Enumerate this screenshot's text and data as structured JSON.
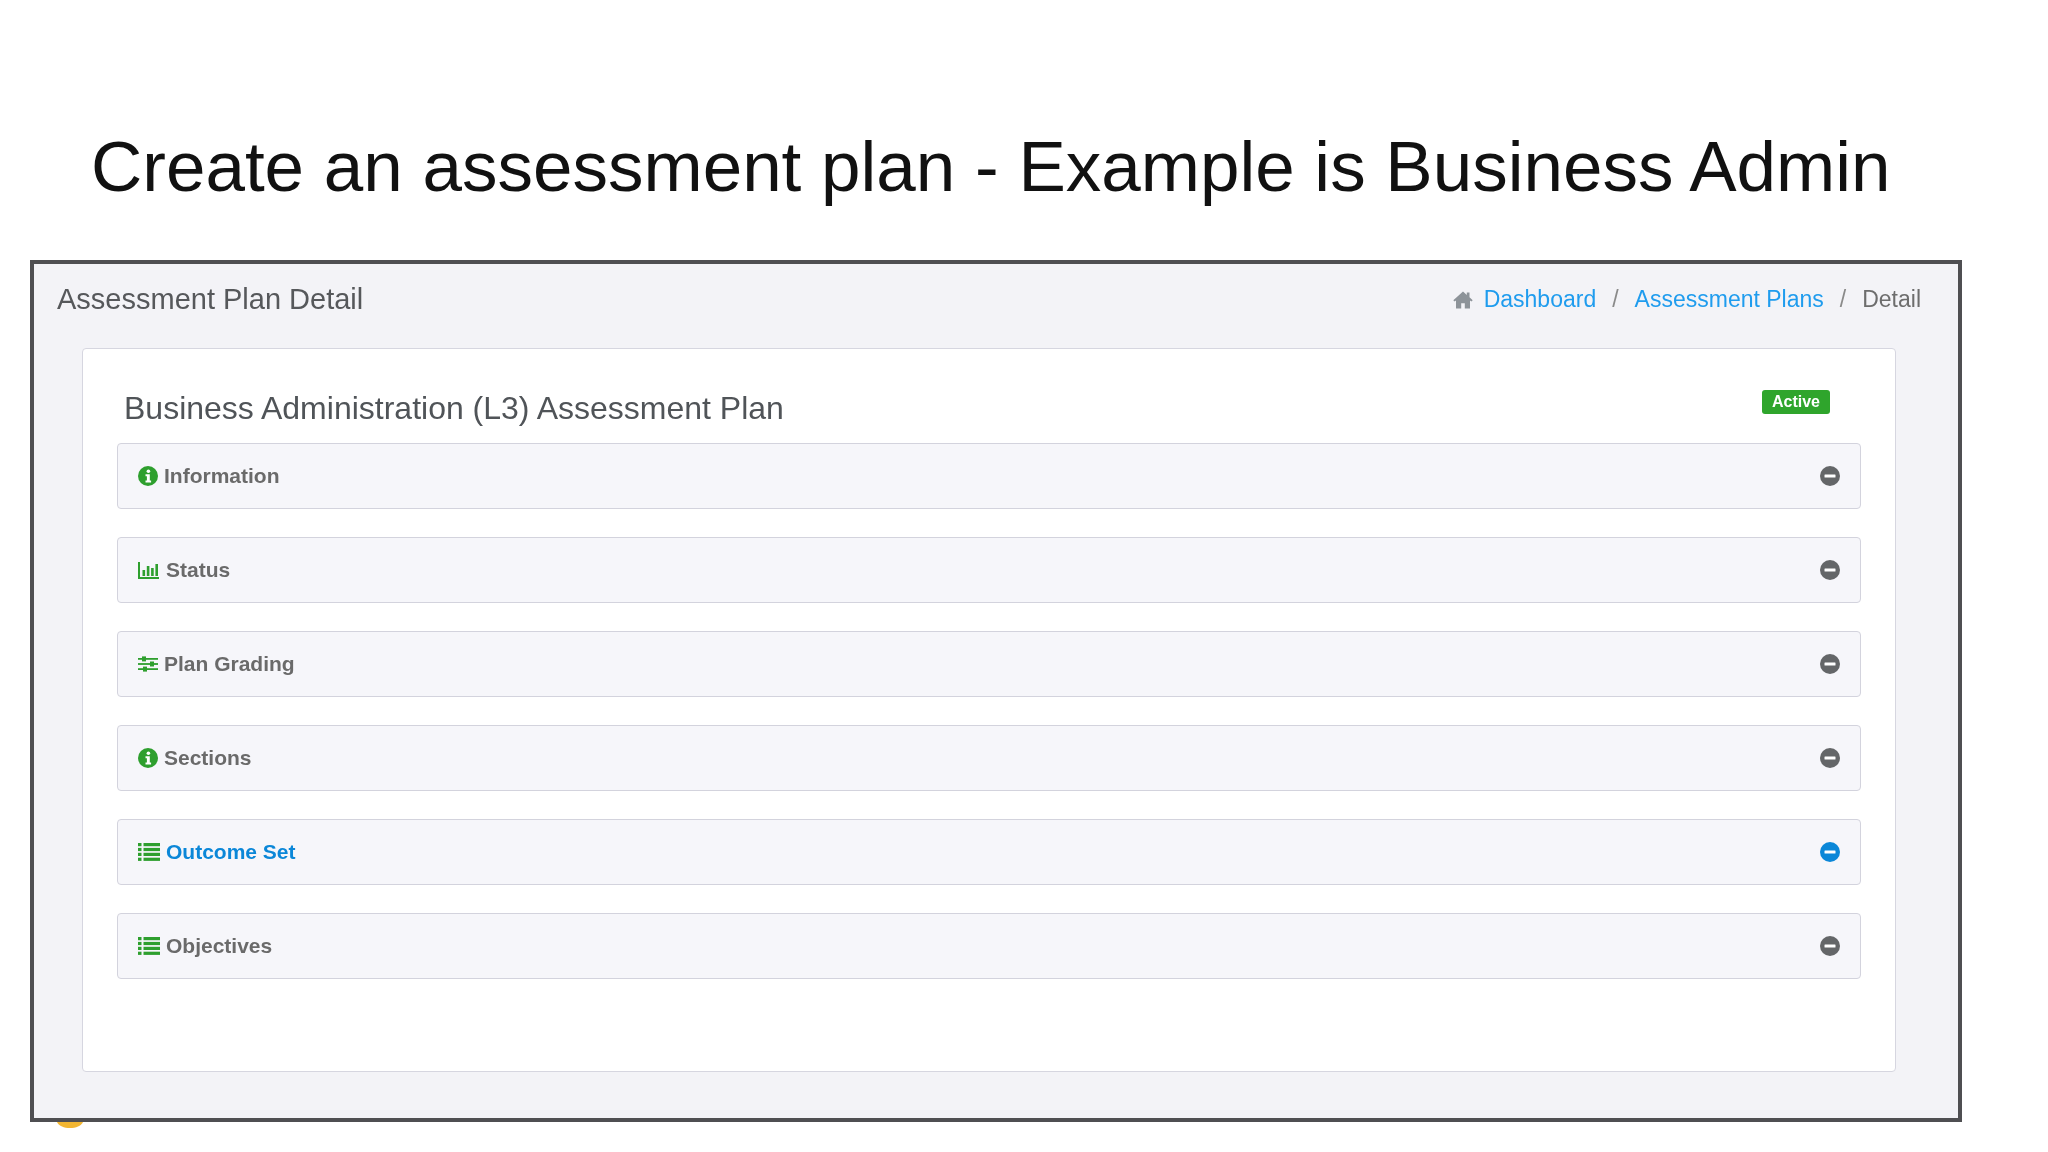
{
  "slide_title": "Create an assessment plan - Example is Business Admin",
  "page": {
    "title": "Assessment Plan Detail",
    "breadcrumb": [
      {
        "kind": "link",
        "label": "Dashboard"
      },
      {
        "kind": "separator",
        "label": "/"
      },
      {
        "kind": "link",
        "label": "Assessment Plans"
      },
      {
        "kind": "separator",
        "label": "/"
      },
      {
        "kind": "current",
        "label": "Detail"
      }
    ]
  },
  "plan": {
    "title": "Business Administration (L3) Assessment Plan",
    "status": {
      "kind": "success",
      "label": "Active"
    },
    "panels": [
      {
        "title": "Information",
        "kind": "info",
        "expanded": true,
        "highlighted": false
      },
      {
        "title": "Status",
        "kind": "chart",
        "expanded": true,
        "highlighted": false
      },
      {
        "title": "Plan Grading",
        "kind": "sliders",
        "expanded": true,
        "highlighted": false
      },
      {
        "title": "Sections",
        "kind": "info",
        "expanded": true,
        "highlighted": false
      },
      {
        "title": "Outcome Set",
        "kind": "list",
        "expanded": true,
        "highlighted": true
      },
      {
        "title": "Objectives",
        "kind": "list",
        "expanded": true,
        "highlighted": false
      }
    ]
  }
}
